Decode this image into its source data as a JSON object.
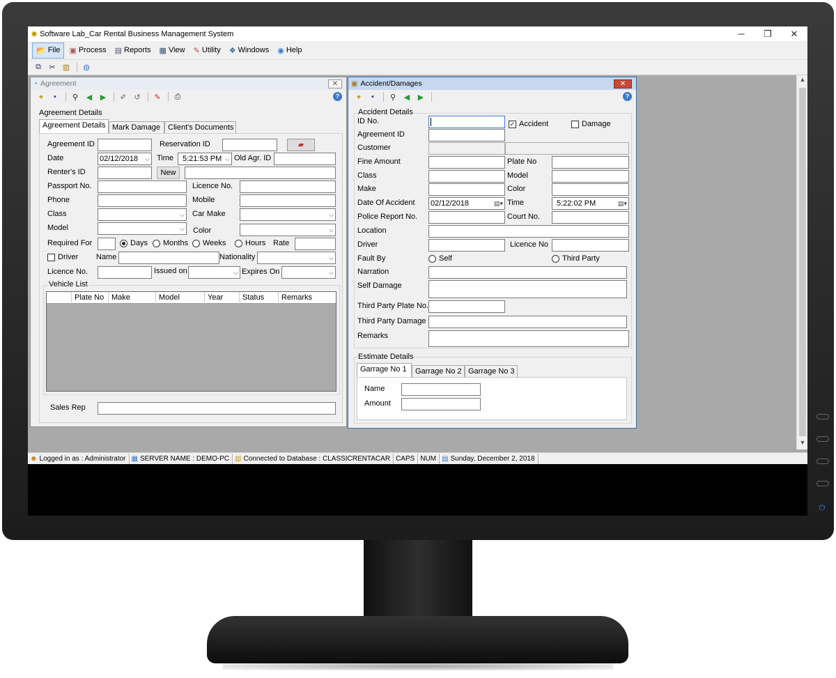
{
  "app": {
    "title": "Software Lab_Car Rental Business Management System",
    "window_controls": {
      "minimize": "─",
      "restore": "❐",
      "close": "✕"
    }
  },
  "menu": [
    {
      "label": "File",
      "icon": "folder-icon"
    },
    {
      "label": "Process",
      "icon": "process-icon"
    },
    {
      "label": "Reports",
      "icon": "reports-icon"
    },
    {
      "label": "View",
      "icon": "view-icon"
    },
    {
      "label": "Utility",
      "icon": "wrench-icon"
    },
    {
      "label": "Windows",
      "icon": "windows-icon"
    },
    {
      "label": "Help",
      "icon": "help-icon"
    }
  ],
  "agreement": {
    "window_title": "Agreement",
    "section_title": "Agreement Details",
    "tabs": [
      "Agreement Details",
      "Mark Damage",
      "Client's Documents"
    ],
    "labels": {
      "agreement_id": "Agreement ID",
      "reservation_id": "Reservation ID",
      "date": "Date",
      "time": "Time",
      "old_agr_id": "Old Agr. ID",
      "renters_id": "Renter's ID",
      "new_button": "New",
      "passport_no": "Passport No.",
      "licence_no": "Licence No.",
      "phone": "Phone",
      "mobile": "Mobile",
      "class": "Class",
      "car_make": "Car Make",
      "model": "Model",
      "color": "Color",
      "required_for": "Required For",
      "days": "Days",
      "months": "Months",
      "weeks": "Weeks",
      "hours": "Hours",
      "rate": "Rate",
      "driver": "Driver",
      "name": "Name",
      "nationality": "Nationality",
      "licence_no2": "Licence No.",
      "issued_on": "Issued on",
      "expires_on": "Expires On",
      "vehicle_list": "Vehicle List",
      "sales_rep": "Sales Rep"
    },
    "values": {
      "date": "02/12/2018",
      "time": "5:21:53 PM"
    },
    "vehicle_columns": [
      "Plate No",
      "Make",
      "Model",
      "Year",
      "Status",
      "Remarks"
    ]
  },
  "accident": {
    "window_title": "Accident/Damages",
    "section_title": "Accident Details",
    "labels": {
      "id_no": "ID No.",
      "accident": "Accident",
      "damage": "Damage",
      "agreement_id": "Agreement ID",
      "customer": "Customer",
      "fine_amount": "Fine Amount",
      "plate_no": "Plate No",
      "class": "Class",
      "model": "Model",
      "make": "Make",
      "color": "Color",
      "date_of_accident": "Date Of Accident",
      "time": "Time",
      "police_report_no": "Police Report No.",
      "court_no": "Court No.",
      "location": "Location",
      "driver": "Driver",
      "licence_no": "Licence No",
      "fault_by": "Fault By",
      "self": "Self",
      "third_party": "Third Party",
      "narration": "Narration",
      "self_damage": "Self Damage",
      "third_party_plate_no": "Third Party Plate No.",
      "third_party_damage": "Third Party Damage",
      "remarks": "Remarks",
      "estimate_details": "Estimate Details",
      "name": "Name",
      "amount": "Amount"
    },
    "values": {
      "date_of_accident": "02/12/2018",
      "time": "5:22:02 PM"
    },
    "estimate_tabs": [
      "Garrage No 1",
      "Garrage No 2",
      "Garrage No 3"
    ]
  },
  "status": {
    "user": "Logged in as : Administrator",
    "server": "SERVER NAME : DEMO-PC",
    "database": "Connected to Database : CLASSICRENTACAR",
    "caps": "CAPS",
    "num": "NUM",
    "date": "Sunday, December 2, 2018"
  }
}
